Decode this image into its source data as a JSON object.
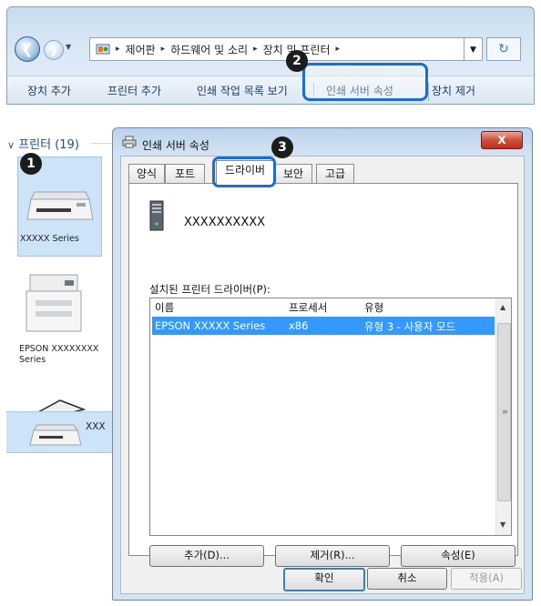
{
  "explorer": {
    "back_glyph": "❮",
    "forward_glyph": "❯",
    "breadcrumb": [
      "제어판",
      "하드웨어 및 소리",
      "장치 및 프린터"
    ],
    "breadcrumb_sep": "▸",
    "dropdown_glyph": "▼",
    "refresh_glyph": "↻",
    "toolbar": [
      "장치 추가",
      "프린터 추가",
      "인쇄 작업 목록 보기",
      "인쇄 서버 속성",
      "장치 제거"
    ]
  },
  "callouts": {
    "one": "1",
    "two": "2",
    "three": "3"
  },
  "left_pane": {
    "group_header": "프린터 (19)",
    "collapse_glyph": "∨",
    "devices": [
      {
        "label": "XXXXX Series"
      },
      {
        "label": "EPSON XXXXXXXX Series"
      },
      {
        "label": "XXX"
      }
    ]
  },
  "dialog": {
    "title": "인쇄 서버 속성",
    "close_glyph": "X",
    "tabs": [
      "양식",
      "포트",
      "드라이버",
      "보안",
      "고급"
    ],
    "active_tab": 2,
    "server_name": "XXXXXXXXXX",
    "drivers_label": "설치된 프린터 드라이버(P):",
    "columns": [
      "이름",
      "프로세서",
      "유형"
    ],
    "rows": [
      {
        "name": "EPSON XXXXX Series",
        "processor": "x86",
        "type": "유형 3 - 사용자 모드"
      }
    ],
    "buttons": {
      "add": "추가(D)...",
      "remove": "제거(R)...",
      "properties": "속성(E)"
    },
    "footer": {
      "ok": "확인",
      "cancel": "취소",
      "apply": "적용(A)"
    }
  },
  "colors": {
    "highlight_ring": "#1a6cd6",
    "selection": "#3399ff",
    "selected_device_bg": "#cde3f8"
  }
}
